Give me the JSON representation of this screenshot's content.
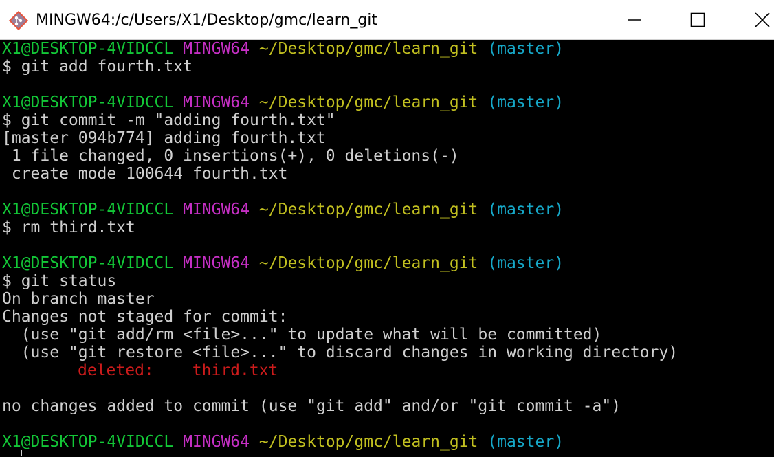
{
  "window": {
    "title": "MINGW64:/c/Users/X1/Desktop/gmc/learn_git",
    "icon": "git-icon",
    "controls": [
      "minimize-icon",
      "maximize-icon",
      "close-icon"
    ]
  },
  "prompt": {
    "user": "X1@DESKTOP-4VIDCCL",
    "system": "MINGW64",
    "path": "~/Desktop/gmc/learn_git",
    "branch": "(master)"
  },
  "lines": {
    "cmd1": "$ git add fourth.txt",
    "cmd2": "$ git commit -m \"adding fourth.txt\"",
    "out2_1": "[master 094b774] adding fourth.txt",
    "out2_2": " 1 file changed, 0 insertions(+), 0 deletions(-)",
    "out2_3": " create mode 100644 fourth.txt",
    "cmd3": "$ rm third.txt",
    "cmd4": "$ git status",
    "out4_1": "On branch master",
    "out4_2": "Changes not staged for commit:",
    "out4_3": "  (use \"git add/rm <file>...\" to update what will be committed)",
    "out4_4": "  (use \"git restore <file>...\" to discard changes in working directory)",
    "deleted_label": "deleted:",
    "deleted_file": "third.txt",
    "out4_5": "no changes added to commit (use \"git add\" and/or \"git commit -a\")"
  },
  "colors": {
    "user": "#13c737",
    "system": "#c52fc4",
    "path": "#c1bf20",
    "branch": "#16a8c8",
    "deleted": "#cc1b1b",
    "text": "#cfcfcf",
    "background": "#000000"
  }
}
